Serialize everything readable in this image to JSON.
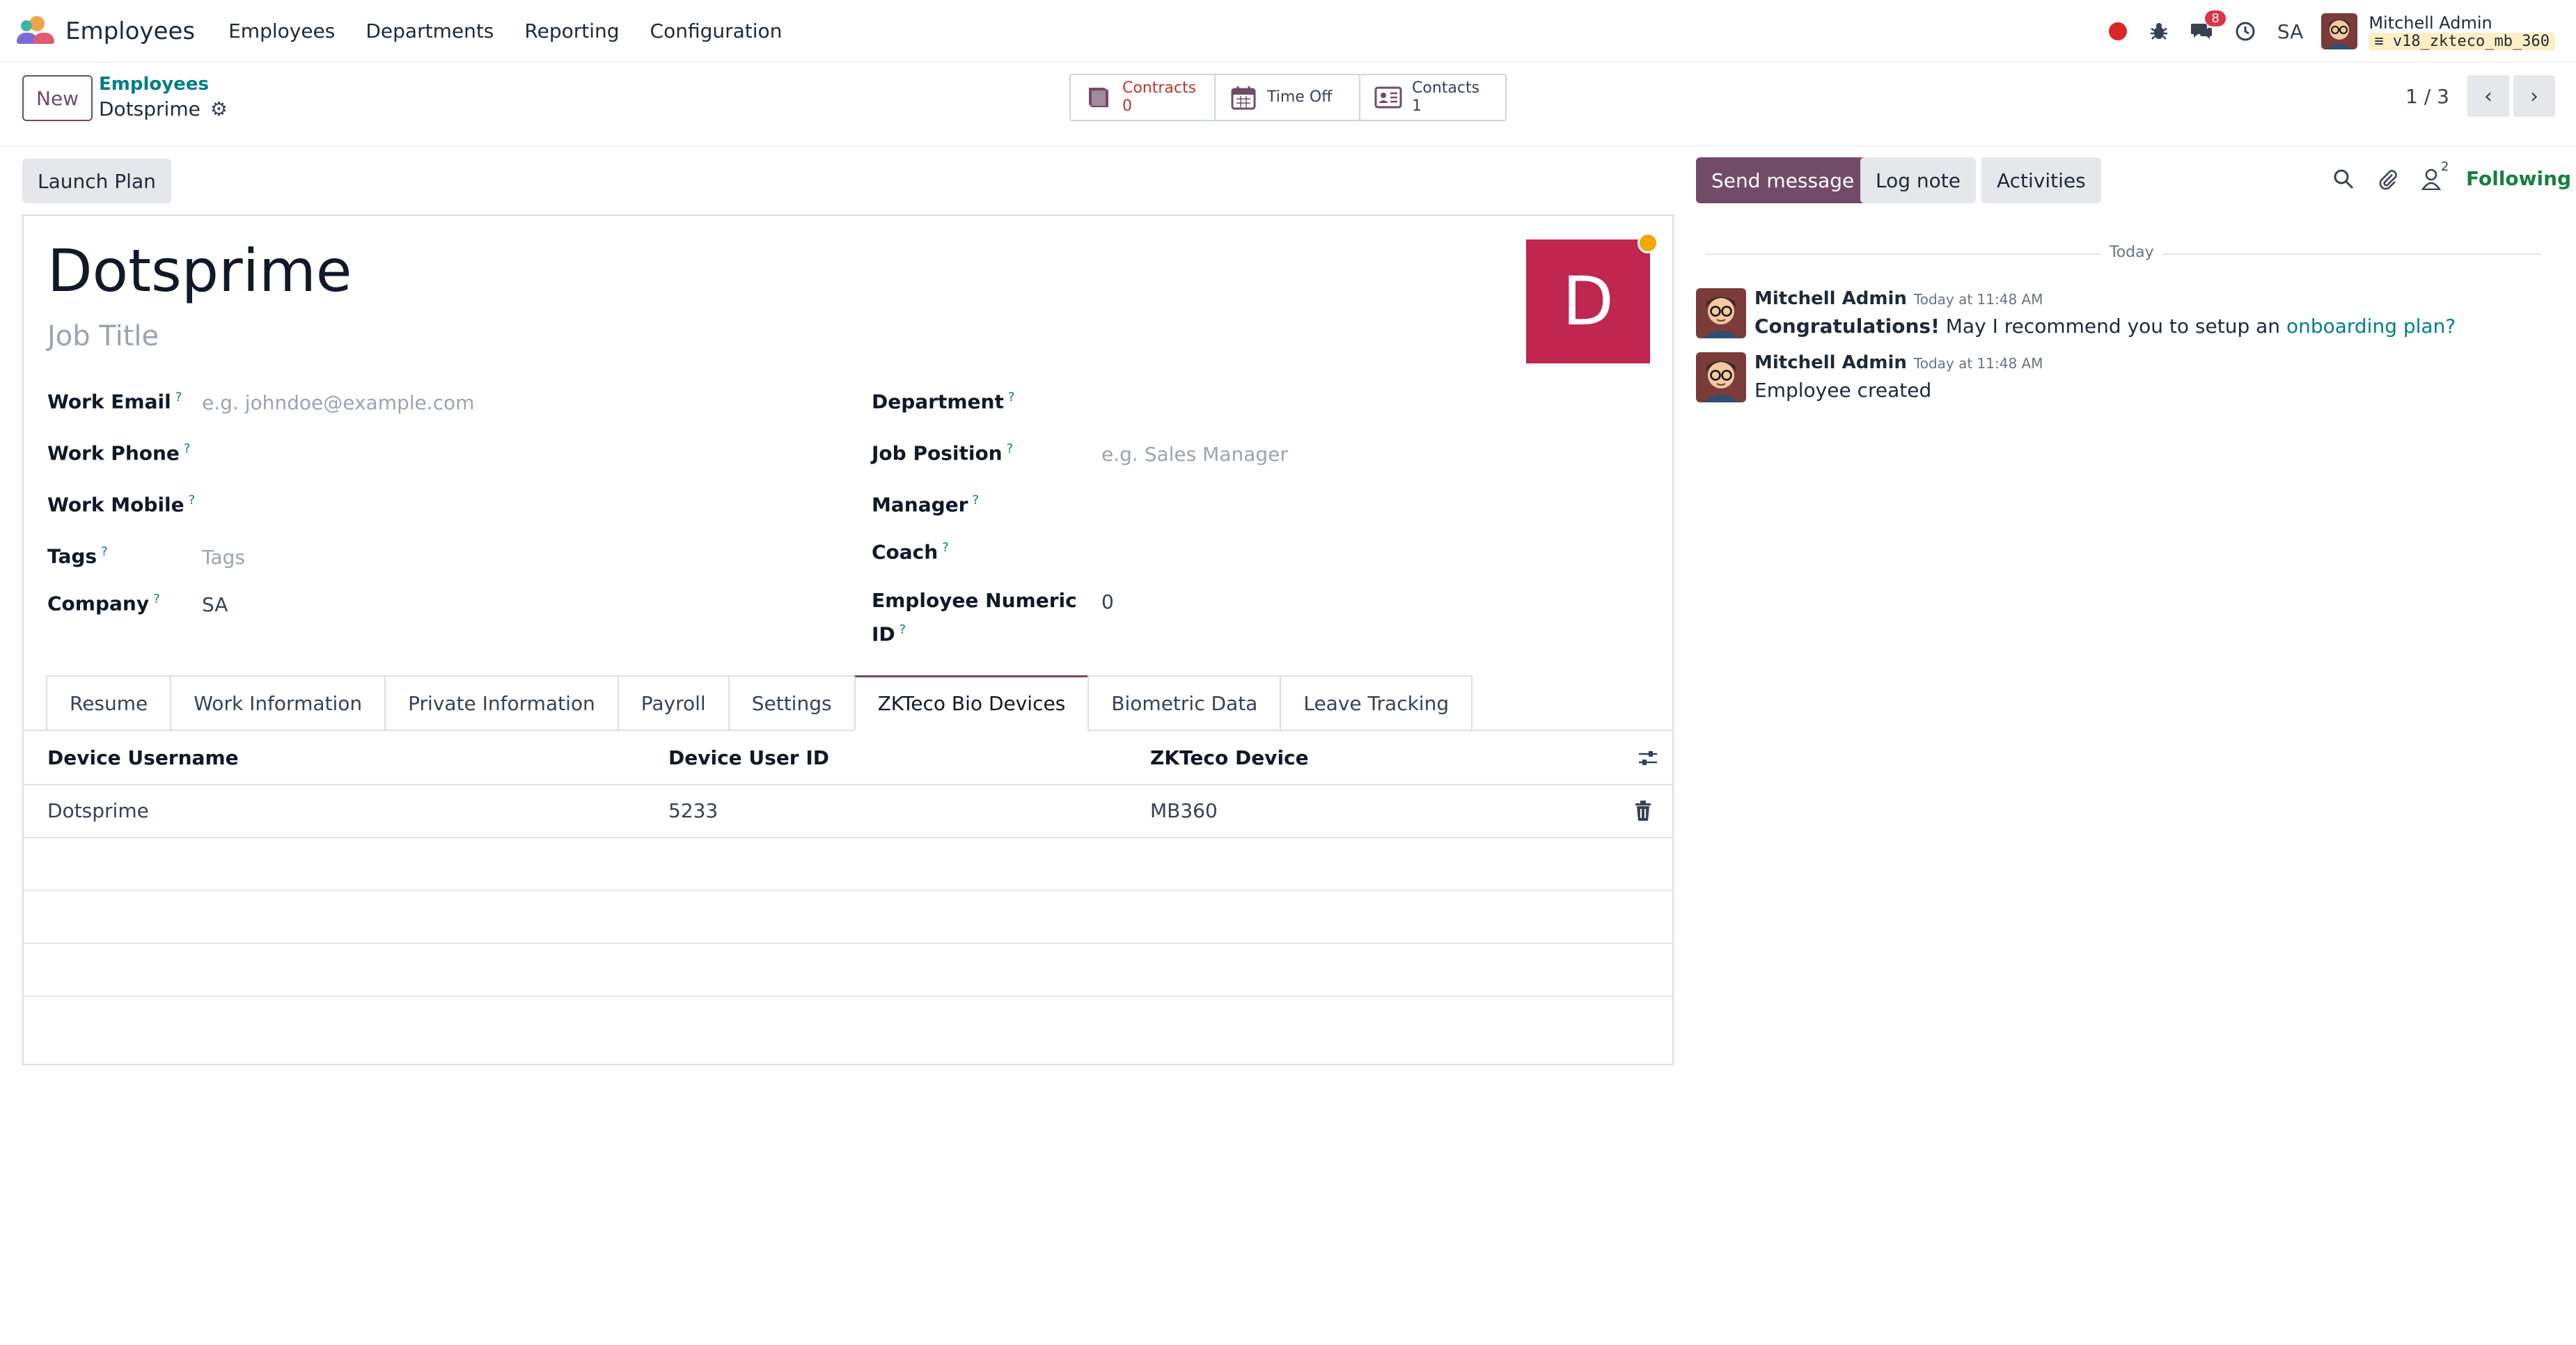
{
  "navbar": {
    "app_name": "Employees",
    "menu": [
      "Employees",
      "Departments",
      "Reporting",
      "Configuration"
    ],
    "messages_badge": "8",
    "company": "SA",
    "user_name": "Mitchell Admin",
    "db_name": "v18_zkteco_mb_360"
  },
  "control": {
    "new_label": "New",
    "breadcrumb_parent": "Employees",
    "breadcrumb_current": "Dotsprime",
    "smart_buttons": [
      {
        "label": "Contracts",
        "value": "0",
        "icon": "book-icon"
      },
      {
        "label": "Time Off",
        "value": "",
        "icon": "calendar-icon"
      },
      {
        "label": "Contacts",
        "value": "1",
        "icon": "contact-card-icon"
      }
    ],
    "pager": "1 / 3"
  },
  "form": {
    "status_button": "Launch Plan",
    "name": "Dotsprime",
    "job_title_placeholder": "Job Title",
    "avatar_letter": "D",
    "left_fields": [
      {
        "label": "Work Email",
        "value": "",
        "placeholder": "e.g. johndoe@example.com"
      },
      {
        "label": "Work Phone",
        "value": ""
      },
      {
        "label": "Work Mobile",
        "value": ""
      },
      {
        "label": "Tags",
        "value": "",
        "placeholder": "Tags"
      },
      {
        "label": "Company",
        "value": "SA"
      }
    ],
    "right_fields": [
      {
        "label": "Department",
        "value": ""
      },
      {
        "label": "Job Position",
        "value": "",
        "placeholder": "e.g. Sales Manager"
      },
      {
        "label": "Manager",
        "value": ""
      },
      {
        "label": "Coach",
        "value": ""
      },
      {
        "label": "Employee Numeric",
        "label2": "ID",
        "value": "0"
      }
    ],
    "help_mark": "?",
    "tabs": [
      "Resume",
      "Work Information",
      "Private Information",
      "Payroll",
      "Settings",
      "ZKTeco Bio Devices",
      "Biometric Data",
      "Leave Tracking"
    ],
    "active_tab": "ZKTeco Bio Devices",
    "table": {
      "columns": [
        "Device Username",
        "Device User ID",
        "ZKTeco Device"
      ],
      "rows": [
        {
          "username": "Dotsprime",
          "user_id": "5233",
          "device": "MB360"
        }
      ]
    }
  },
  "chatter": {
    "send_message": "Send message",
    "log_note": "Log note",
    "activities": "Activities",
    "followers_count": "2",
    "following": "Following",
    "separator": "Today",
    "messages": [
      {
        "author": "Mitchell Admin",
        "date": "Today at 11:48 AM",
        "bold": "Congratulations!",
        "text": " May I recommend you to setup an ",
        "link": "onboarding plan?"
      },
      {
        "author": "Mitchell Admin",
        "date": "Today at 11:48 AM",
        "bold": "",
        "text": "Employee created",
        "link": ""
      }
    ]
  },
  "colors": {
    "brand": "#714b67",
    "link": "#017e84",
    "avatar_bg": "#c0264f",
    "following": "#17803d"
  }
}
